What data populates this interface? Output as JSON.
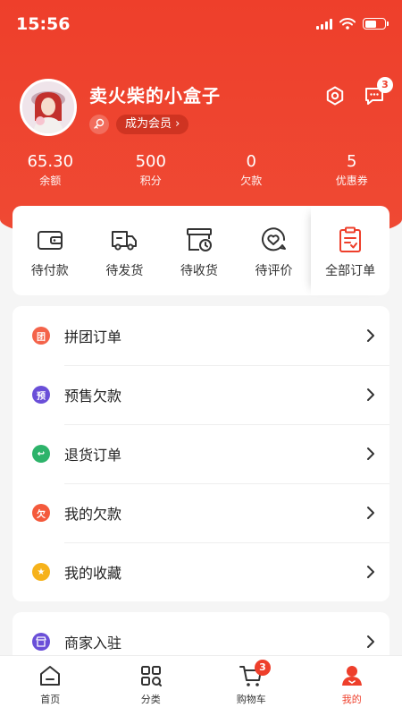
{
  "status": {
    "time": "15:56"
  },
  "profile": {
    "username": "卖火柴的小盒子",
    "member_label": "成为会员",
    "message_count": "3"
  },
  "stats": [
    {
      "value": "65.30",
      "label": "余额"
    },
    {
      "value": "500",
      "label": "积分"
    },
    {
      "value": "0",
      "label": "欠款"
    },
    {
      "value": "5",
      "label": "优惠券"
    }
  ],
  "orders": [
    {
      "label": "待付款",
      "icon": "wallet-icon"
    },
    {
      "label": "待发货",
      "icon": "truck-icon"
    },
    {
      "label": "待收货",
      "icon": "package-clock-icon"
    },
    {
      "label": "待评价",
      "icon": "heart-comment-icon"
    },
    {
      "label": "全部订单",
      "icon": "clipboard-icon"
    }
  ],
  "menu": [
    {
      "label": "拼团订单",
      "icon_text": "团",
      "color": "#f4634a"
    },
    {
      "label": "预售欠款",
      "icon_text": "预",
      "color": "#6a4fd8"
    },
    {
      "label": "退货订单",
      "icon_text": "↩",
      "color": "#2db36a"
    },
    {
      "label": "我的欠款",
      "icon_text": "欠",
      "color": "#f45a3c"
    },
    {
      "label": "我的收藏",
      "icon_text": "★",
      "color": "#f6b21b"
    }
  ],
  "menu2": [
    {
      "label": "商家入驻",
      "icon_text": "店",
      "color": "#6a4fd8"
    }
  ],
  "tabs": [
    {
      "label": "首页",
      "icon": "home-icon"
    },
    {
      "label": "分类",
      "icon": "category-icon"
    },
    {
      "label": "购物车",
      "icon": "cart-icon",
      "badge": "3"
    },
    {
      "label": "我的",
      "icon": "profile-icon",
      "active": true
    }
  ],
  "colors": {
    "accent": "#ee3f2b",
    "background": "#f5f5f5"
  }
}
